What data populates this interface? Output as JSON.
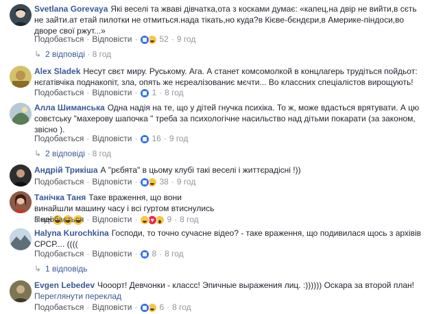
{
  "like_label": "Подобається",
  "reply_label": "Відповісти",
  "comments": [
    {
      "author": "Svetlana Gorevaya",
      "text": "Які веселі та жваві дівчатка,ота з косками думає: «капец,на двір не вийти,в сєть не зайти.ат етай пилотки не отмиться.нада тікать,но куда?в Кієве-бєндєри,в Америке-піндоси,во дворе свої ржут...»",
      "reactions": [
        "like",
        "haha"
      ],
      "count": "52",
      "time": "9 год",
      "replies": "2 відповіді",
      "replies_time": "8 год"
    },
    {
      "author": "Alex Sladek",
      "text": "Несут свєт миру. Руському. Ага. А станет комсомолкой в концлагерь трудіться пойдьот: нєгатівчіка поднакопіт, зла, опять же нєреалізованиє мєчти... Во классних спеціалістов вирощують!",
      "reactions": [
        "like"
      ],
      "count": "1",
      "time": "8 год"
    },
    {
      "author": "Алла Шиманська",
      "text": "Одна надія на те, що у дітей гнучка психіка. То ж, може вдасться врятувати. А цю совєтську \"махерову шапочка \" треба за психологічне насильство над дітьми покарати (за законом, звісно ).",
      "reactions": [
        "like"
      ],
      "count": "16",
      "time": "9 год",
      "replies": "2 відповіді",
      "replies_time": "8 год"
    },
    {
      "author": "Андрій Трикіша",
      "text": "А \"рєбята\" в цьому клубі такі веселі і життєрадісні !))",
      "reactions": [
        "like",
        "haha"
      ],
      "count": "38",
      "time": "9 год"
    },
    {
      "author": "Танічка Таня",
      "text": "Таке враження, що вони винайшли машину часу і всі гуртом втиснулись в неї",
      "reactions": [
        "haha",
        "love",
        "wow"
      ],
      "count": "9",
      "time": "8 год"
    },
    {
      "author": "Halyna Kurochkina",
      "text": "Господи, то точно сучасне відео? - таке враження, що подивилася щось з архівів СРСР.... ((((",
      "reactions": [
        "like"
      ],
      "count": "8",
      "time": "8 год",
      "replies": "1 відповідь",
      "replies_time": "8 год"
    },
    {
      "author": "Evgen Lebedev",
      "text": "Чооорт! Девчонки - классс! Эпичные выражения лиц. :)))))) Оскара за второй план!",
      "translate": "Переглянути переклад",
      "reactions": [
        "like",
        "haha"
      ],
      "count": "6",
      "time": "8 год"
    }
  ]
}
